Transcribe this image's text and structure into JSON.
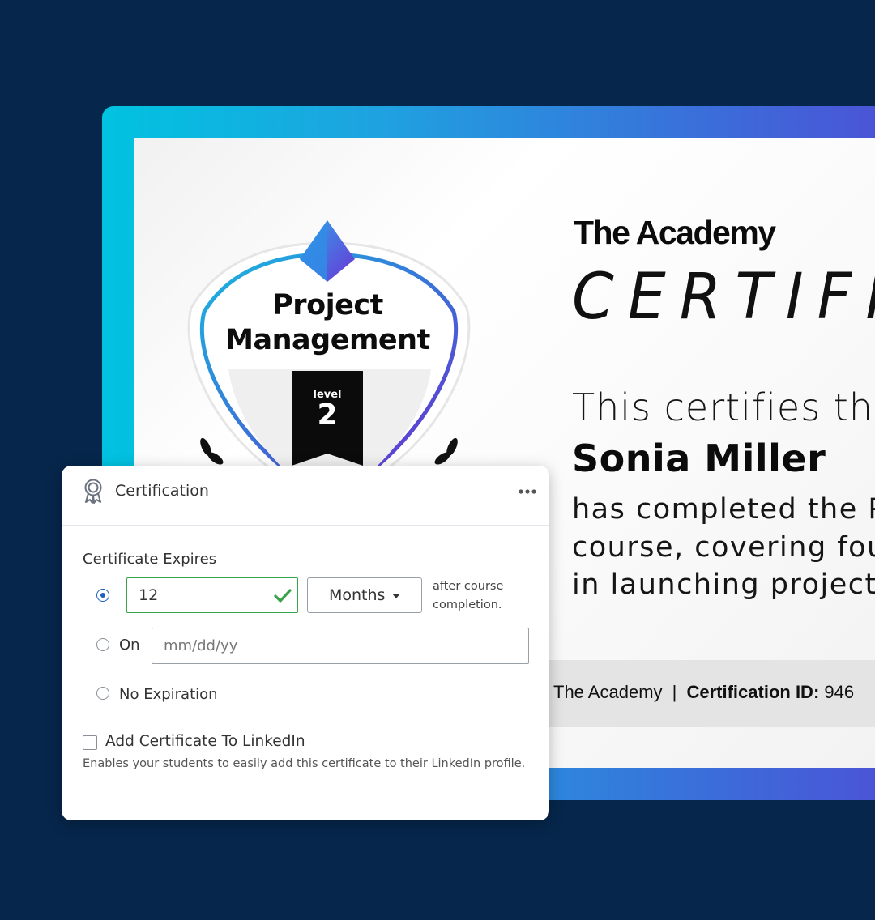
{
  "certificate": {
    "academy_name": "The Academy",
    "heading": "CERTIFI",
    "certifies_text": "This certifies that",
    "recipient_name": "Sonia Miller",
    "completion_lines": [
      "has completed the Pro",
      "course, covering foun",
      "in launching projects."
    ],
    "footer_org": "The Academy",
    "footer_separator": "|",
    "footer_id_label": "Certification ID:",
    "footer_id_value": "946",
    "badge": {
      "title_line1": "Project",
      "title_line2": "Management",
      "level_word": "level",
      "level_number": "2"
    }
  },
  "panel": {
    "title": "Certification",
    "icon": "award-ribbon-icon",
    "menu_icon": "more-horizontal-icon",
    "expires_label": "Certificate Expires",
    "duration": {
      "value": "12",
      "unit": "Months",
      "suffix": "after course completion.",
      "selected": true
    },
    "on_date": {
      "label": "On",
      "placeholder": "mm/dd/yy",
      "selected": false
    },
    "no_expiration": {
      "label": "No Expiration",
      "selected": false
    },
    "linkedin": {
      "label": "Add Certificate To LinkedIn",
      "checked": false,
      "help": "Enables your students to easily add this certificate to their LinkedIn profile."
    }
  },
  "colors": {
    "background": "#06264b",
    "frame_start": "#00c3e0",
    "frame_end": "#4c52d6",
    "valid_green": "#3aa24a",
    "radio_blue": "#1f5fbf"
  }
}
